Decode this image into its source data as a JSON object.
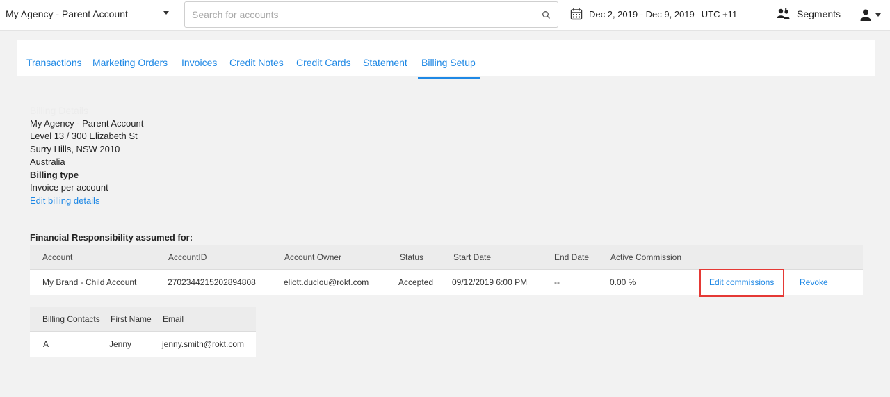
{
  "topbar": {
    "account_name": "My Agency - Parent Account",
    "search_placeholder": "Search for accounts",
    "date_range": "Dec 2, 2019 - Dec 9, 2019",
    "timezone": "UTC +11",
    "segments_label": "Segments",
    "icons": {
      "account_dropdown": "chevron-down-icon",
      "search": "search-icon",
      "calendar": "calendar-icon",
      "segments": "segments-icon",
      "user": "user-icon"
    }
  },
  "tabs": [
    {
      "label": "Transactions",
      "active": false
    },
    {
      "label": "Marketing Orders",
      "active": false
    },
    {
      "label": "Invoices",
      "active": false
    },
    {
      "label": "Credit Notes",
      "active": false
    },
    {
      "label": "Credit Cards",
      "active": false
    },
    {
      "label": "Statement",
      "active": false
    },
    {
      "label": "Billing Setup",
      "active": true
    }
  ],
  "billing": {
    "heading": "Billing Details",
    "address_lines": [
      "My Agency - Parent Account",
      "Level 13 / 300 Elizabeth St",
      "Surry Hills, NSW 2010",
      "Australia"
    ],
    "billing_type_label": "Billing type",
    "billing_type_value": "Invoice per account",
    "edit_link": "Edit billing details"
  },
  "financial": {
    "title": "Financial Responsibility assumed for:",
    "columns": [
      "Account",
      "AccountID",
      "Account Owner",
      "Status",
      "Start Date",
      "End Date",
      "Active Commission"
    ],
    "rows": [
      {
        "account": "My Brand - Child Account",
        "account_id": "2702344215202894808",
        "owner": "eliott.duclou@rokt.com",
        "status": "Accepted",
        "start_date": "09/12/2019 6:00 PM",
        "end_date": "--",
        "commission": "0.00 %",
        "edit_action": "Edit commissions",
        "revoke_action": "Revoke"
      }
    ]
  },
  "contacts": {
    "columns": [
      "Billing Contacts",
      "First Name",
      "Email"
    ],
    "rows": [
      {
        "contact": "A",
        "first_name": "Jenny",
        "email": "jenny.smith@rokt.com"
      }
    ]
  },
  "colors": {
    "accent": "#1e88e5",
    "highlight": "#e53935",
    "background": "#f2f2f2"
  }
}
